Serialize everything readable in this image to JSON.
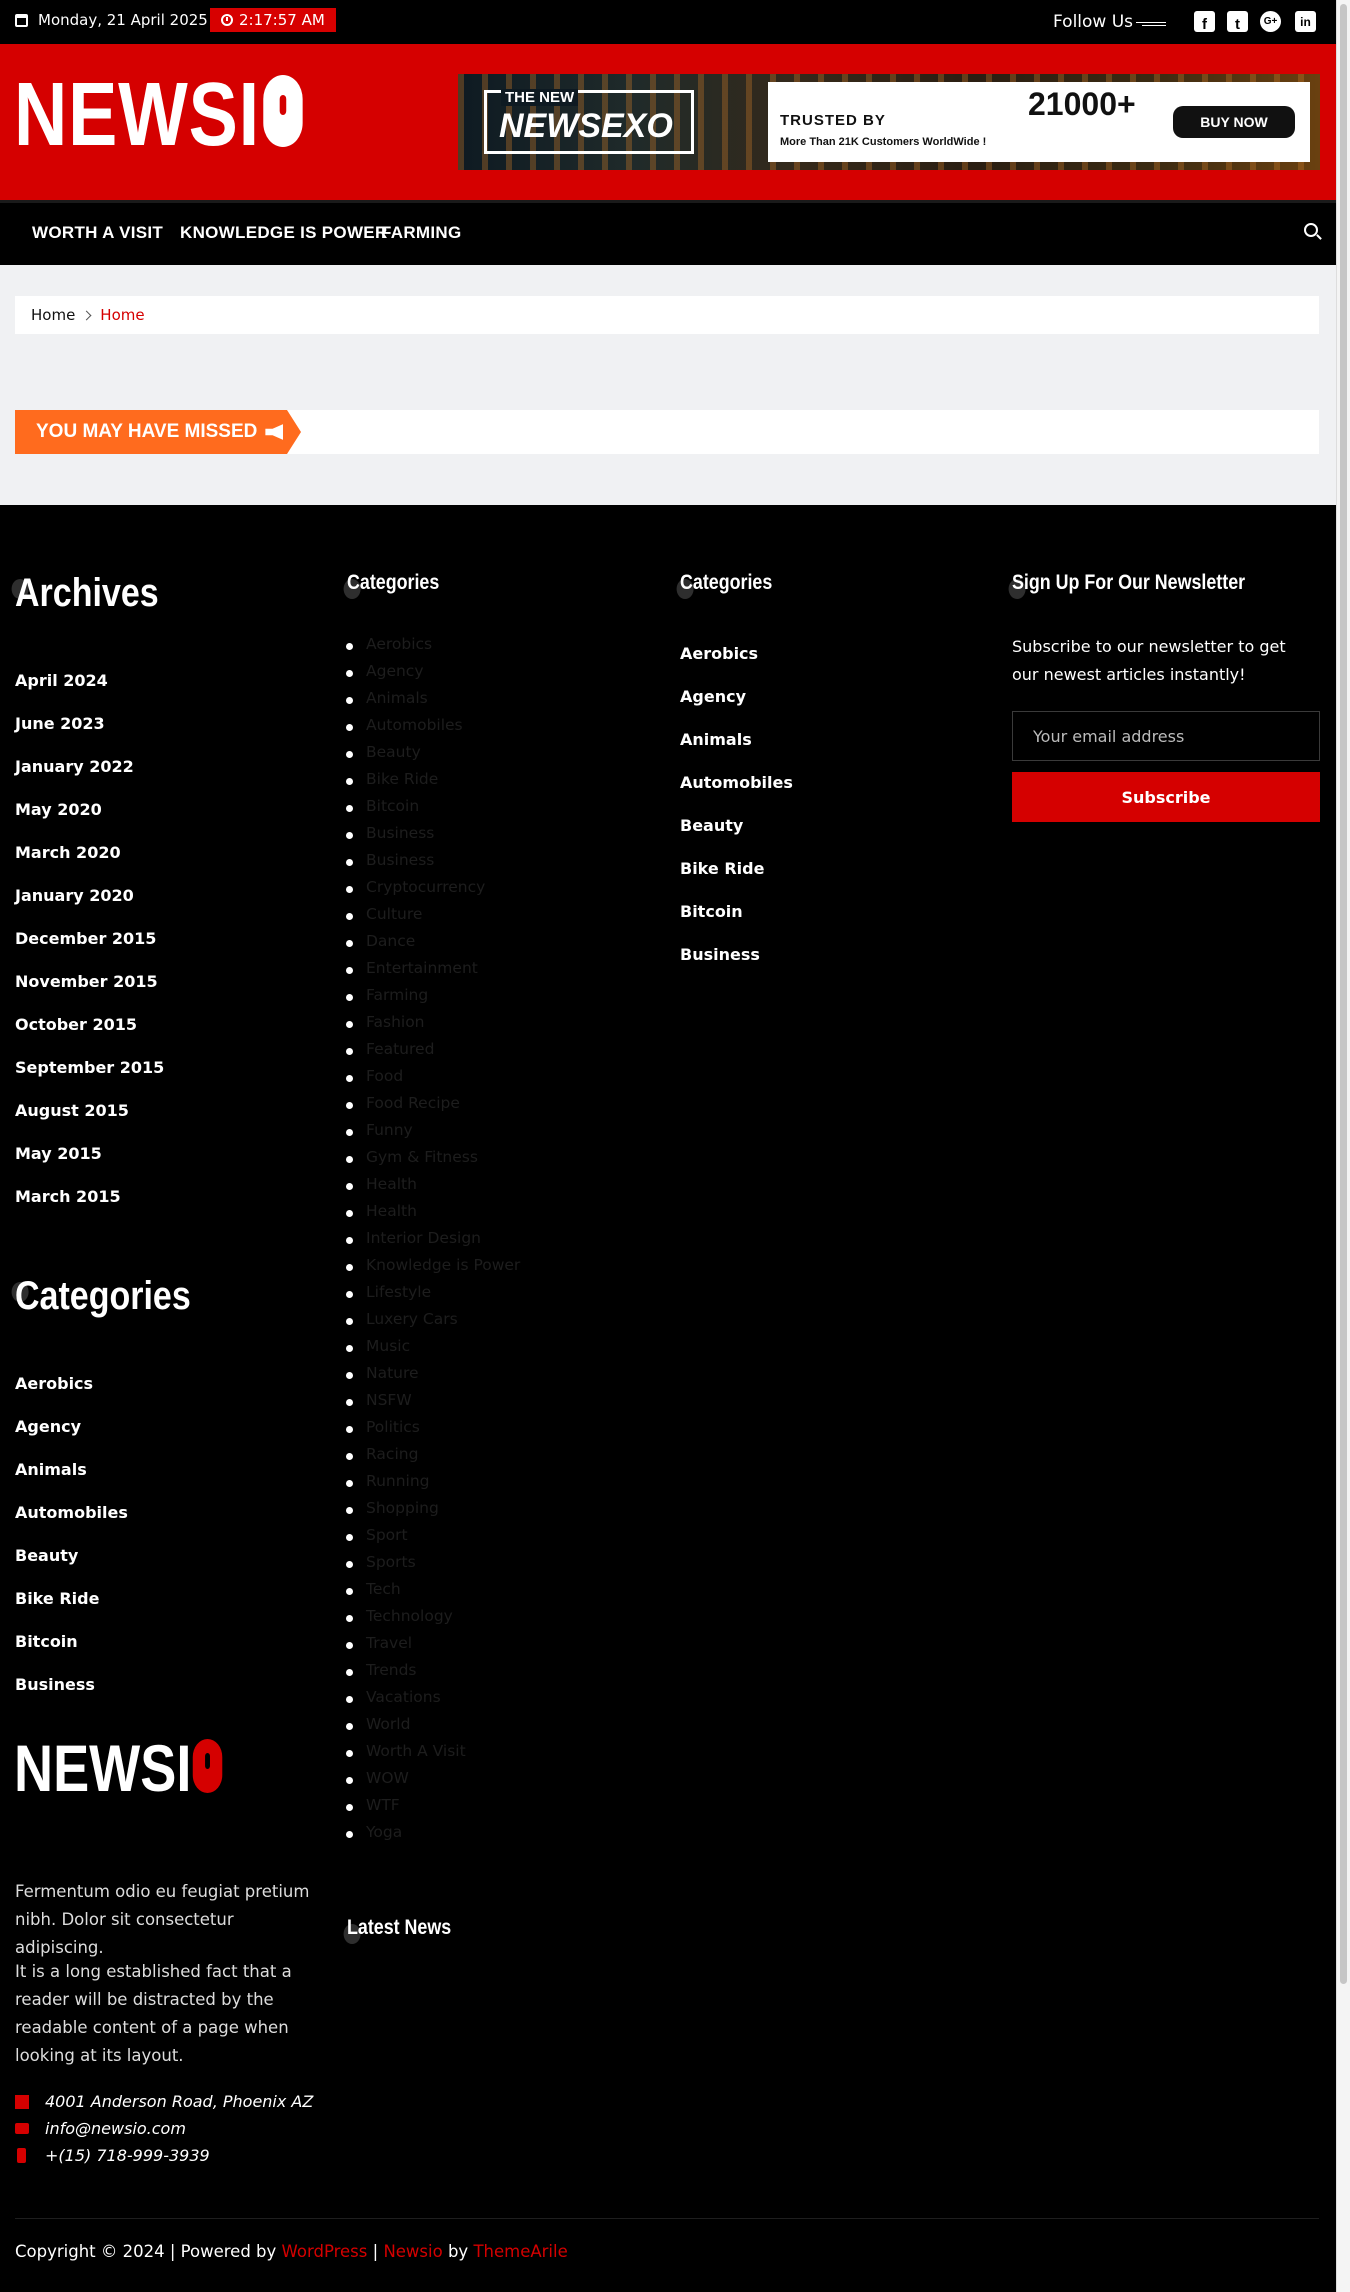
{
  "topbar": {
    "date": "Monday, 21 April 2025",
    "time": "2:17:57 AM",
    "follow_label": "Follow Us",
    "social_icons": [
      "facebook-square-icon",
      "twitter-square-icon",
      "google-plus-icon",
      "linkedin-icon"
    ]
  },
  "header": {
    "logo_text": "NEWSI",
    "ad": {
      "the_new": "THE NEW",
      "brand": "NEWSEXO",
      "trusted": "TRUSTED BY",
      "more": "More Than 21K Customers WorldWide !",
      "count": "21000+",
      "buy": "BUY NOW"
    }
  },
  "nav": {
    "items": [
      "Worth A Visit",
      "Knowledge is Power",
      "Farming"
    ],
    "search_icon": "search-icon"
  },
  "breadcrumb": {
    "home": "Home",
    "current": "Home"
  },
  "missed": {
    "label": "YOU MAY HAVE MISSED"
  },
  "footer": {
    "archives": {
      "title": "Archives",
      "items": [
        "April 2024",
        "June 2023",
        "January 2022",
        "May 2020",
        "March 2020",
        "January 2020",
        "December 2015",
        "November 2015",
        "October 2015",
        "September 2015",
        "August 2015",
        "May 2015",
        "March 2015"
      ]
    },
    "categories_left": {
      "title": "Categories",
      "items": [
        "Aerobics",
        "Agency",
        "Animals",
        "Automobiles",
        "Beauty",
        "Bike Ride",
        "Bitcoin",
        "Business"
      ]
    },
    "categories_list": {
      "title": "Categories",
      "items": [
        "Aerobics",
        "Agency",
        "Animals",
        "Automobiles",
        "Beauty",
        "Bike Ride",
        "Bitcoin",
        "Business",
        "Business",
        "Cryptocurrency",
        "Culture",
        "Dance",
        "Entertainment",
        "Farming",
        "Fashion",
        "Featured",
        "Food",
        "Food Recipe",
        "Funny",
        "Gym & Fitness",
        "Health",
        "Health",
        "Interior Design",
        "Knowledge is Power",
        "Lifestyle",
        "Luxery Cars",
        "Music",
        "Nature",
        "NSFW",
        "Politics",
        "Racing",
        "Running",
        "Shopping",
        "Sport",
        "Sports",
        "Tech",
        "Technology",
        "Travel",
        "Trends",
        "Vacations",
        "World",
        "Worth A Visit",
        "WOW",
        "WTF",
        "Yoga"
      ]
    },
    "latest_news": {
      "title": "Latest News"
    },
    "categories_right": {
      "title": "Categories",
      "items": [
        "Aerobics",
        "Agency",
        "Animals",
        "Automobiles",
        "Beauty",
        "Bike Ride",
        "Bitcoin",
        "Business"
      ]
    },
    "newsletter": {
      "title": "Sign Up For Our Newsletter",
      "text": "Subscribe to our newsletter to get our newest articles instantly!",
      "placeholder": "Your email address",
      "button": "Subscribe"
    },
    "about": {
      "logo_text": "NEWSI",
      "text1": "Fermentum odio eu feugiat pretium nibh. Dolor sit consectetur adipiscing.",
      "text2": "It is a long established fact that a reader will be distracted by the readable content of a page when looking at its layout.",
      "address": "4001 Anderson Road, Phoenix AZ",
      "email": "info@newsio.com",
      "phone": "+(15) 718-999-3939"
    },
    "copyright": {
      "prefix": "Copyright © 2024 | Powered by ",
      "wordpress": "WordPress",
      "sep": " | ",
      "theme": "Newsio",
      "by": " by ",
      "author": "ThemeArile"
    }
  }
}
